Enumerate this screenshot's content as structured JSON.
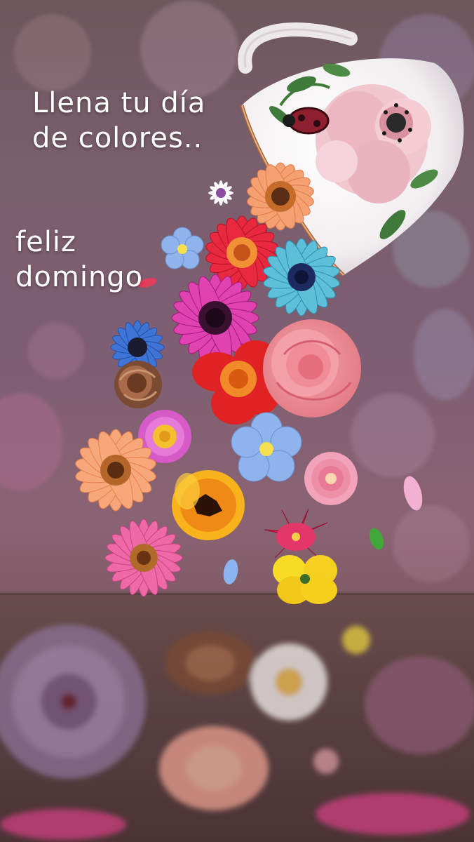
{
  "greeting": {
    "line1": "Llena tu día",
    "line2": "de colores..",
    "line3": "feliz",
    "line4": "domingo"
  },
  "scene": {
    "objects": [
      "teacup",
      "pouring-flowers",
      "reflection"
    ],
    "colors": {
      "background": "#7e5e72",
      "tabletop": "#5e4444",
      "text": "#ffffff"
    }
  }
}
